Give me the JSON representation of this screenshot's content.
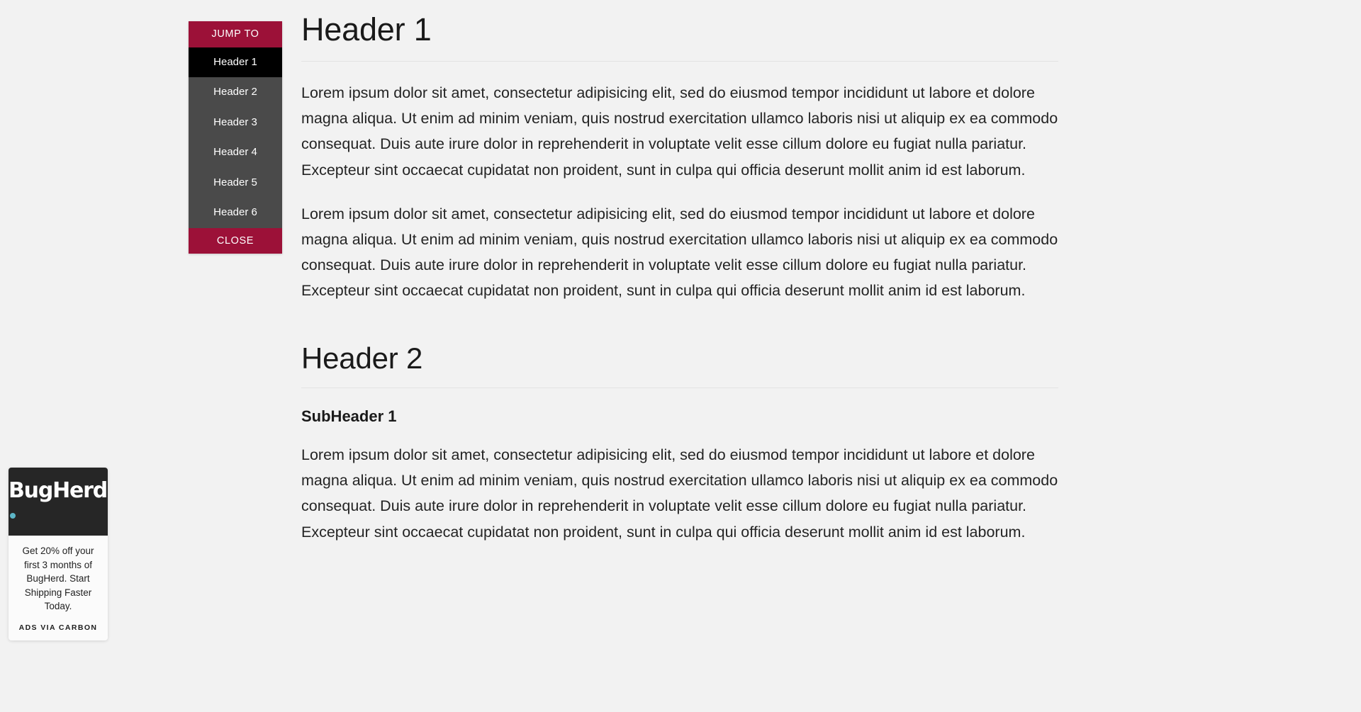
{
  "page": {
    "background_color": "#f2f2f2"
  },
  "jumpto": {
    "title": "JUMP TO",
    "close_label": "CLOSE",
    "accent_color": "#9c1138",
    "panel_color": "#4a4a4a",
    "active_color": "#000000",
    "items": [
      {
        "label": "Header 1",
        "active": true
      },
      {
        "label": "Header 2",
        "active": false
      },
      {
        "label": "Header 3",
        "active": false
      },
      {
        "label": "Header 4",
        "active": false
      },
      {
        "label": "Header 5",
        "active": false
      },
      {
        "label": "Header 6",
        "active": false
      }
    ]
  },
  "content": {
    "heading1": "Header 1",
    "paragraph1": "Lorem ipsum dolor sit amet, consectetur adipisicing elit, sed do eiusmod tempor incididunt ut labore et dolore magna aliqua. Ut enim ad minim veniam, quis nostrud exercitation ullamco laboris nisi ut aliquip ex ea commodo consequat. Duis aute irure dolor in reprehenderit in voluptate velit esse cillum dolore eu fugiat nulla pariatur. Excepteur sint occaecat cupidatat non proident, sunt in culpa qui officia deserunt mollit anim id est laborum.",
    "paragraph2": "Lorem ipsum dolor sit amet, consectetur adipisicing elit, sed do eiusmod tempor incididunt ut labore et dolore magna aliqua. Ut enim ad minim veniam, quis nostrud exercitation ullamco laboris nisi ut aliquip ex ea commodo consequat. Duis aute irure dolor in reprehenderit in voluptate velit esse cillum dolore eu fugiat nulla pariatur. Excepteur sint occaecat cupidatat non proident, sunt in culpa qui officia deserunt mollit anim id est laborum.",
    "heading2": "Header 2",
    "subheading1": "SubHeader 1",
    "paragraph3": "Lorem ipsum dolor sit amet, consectetur adipisicing elit, sed do eiusmod tempor incididunt ut labore et dolore magna aliqua. Ut enim ad minim veniam, quis nostrud exercitation ullamco laboris nisi ut aliquip ex ea commodo consequat. Duis aute irure dolor in reprehenderit in voluptate velit esse cillum dolore eu fugiat nulla pariatur. Excepteur sint occaecat cupidatat non proident, sunt in culpa qui officia deserunt mollit anim id est laborum."
  },
  "ad": {
    "brand": "BugHerd",
    "brand_dot_color": "#5cb5c6",
    "body": "Get 20% off your first 3 months of BugHerd. Start Shipping Faster Today.",
    "poweredby": "ADS VIA CARBON"
  }
}
